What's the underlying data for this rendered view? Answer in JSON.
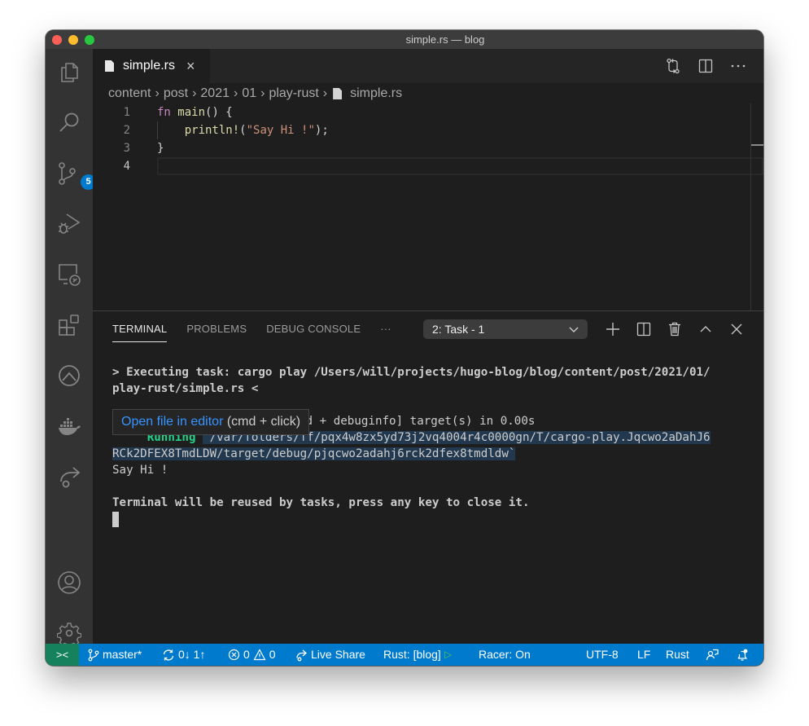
{
  "window": {
    "title": "simple.rs — blog"
  },
  "activity_bar": {
    "items": [
      {
        "name": "explorer",
        "icon": "files-icon"
      },
      {
        "name": "search",
        "icon": "search-icon"
      },
      {
        "name": "source-control",
        "icon": "source-control-icon",
        "badge": "5"
      },
      {
        "name": "run-debug",
        "icon": "run-debug-icon"
      },
      {
        "name": "remote-explorer",
        "icon": "remote-explorer-icon"
      },
      {
        "name": "extensions",
        "icon": "extensions-icon"
      },
      {
        "name": "gitlens",
        "icon": "chevron-circle-icon"
      },
      {
        "name": "docker",
        "icon": "docker-icon"
      },
      {
        "name": "live-share",
        "icon": "live-share-icon"
      }
    ],
    "bottom": [
      {
        "name": "accounts",
        "icon": "account-icon"
      },
      {
        "name": "manage",
        "icon": "gear-icon"
      }
    ]
  },
  "editor": {
    "tab": {
      "label": "simple.rs",
      "close": "×"
    },
    "breadcrumb": [
      "content",
      "post",
      "2021",
      "01",
      "play-rust",
      "simple.rs"
    ],
    "breadcrumb_sep": "›",
    "lines": [
      {
        "number": "1"
      },
      {
        "number": "2"
      },
      {
        "number": "3"
      },
      {
        "number": "4"
      }
    ],
    "code": {
      "l1_kw": "fn",
      "l1_fn": "main",
      "l1_rest": "() {",
      "l2_indent": "    ",
      "l2_fn": "println!",
      "l2_open": "(",
      "l2_str": "\"Say Hi !\"",
      "l2_close": ");",
      "l3": "}"
    }
  },
  "panel": {
    "tabs": [
      {
        "label": "TERMINAL",
        "active": true
      },
      {
        "label": "PROBLEMS",
        "active": false
      },
      {
        "label": "DEBUG CONSOLE",
        "active": false
      }
    ],
    "more": "···",
    "terminal_select": "2: Task - 1",
    "terminal": {
      "line1": "> Executing task: cargo play /Users/will/projects/hugo-blog/blog/content/post/2021/01/",
      "line2": "play-rust/simple.rs <",
      "line4_rest": "ed + debuginfo] target(s) in 0.00s",
      "running_label": "     Running",
      "running_path_1": "`/var/folders/ff/pqx4w8zx5yd73j2vq4004r4c0000gn/T/cargo-play.Jqcwo2aDahJ6",
      "running_path_2": "RCk2DFEX8TmdLDW/target/debug/pjqcwo2adahj6rck2dfex8tmdldw`",
      "output": "Say Hi !",
      "footer": "Terminal will be reused by tasks, press any key to close it."
    },
    "hover": {
      "link": "Open file in editor",
      "hint": " (cmd + click)"
    }
  },
  "status_bar": {
    "remote": "><",
    "branch": "master*",
    "sync": "0↓ 1↑",
    "errors": "0",
    "warnings": "0",
    "live_share": "Live Share",
    "rust_workspace": "Rust: [blog]",
    "racer": "Racer: On",
    "encoding": "UTF-8",
    "eol": "LF",
    "language": "Rust"
  }
}
